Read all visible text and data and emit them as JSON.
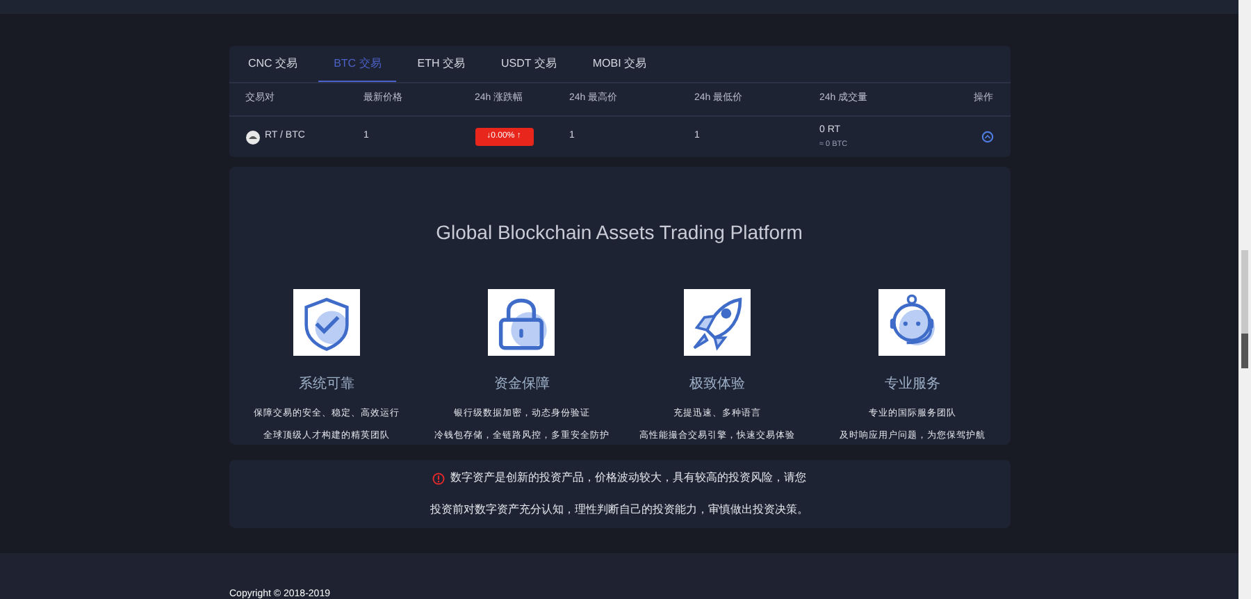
{
  "tabs": [
    {
      "label": "CNC 交易",
      "selected": false
    },
    {
      "label": "BTC 交易",
      "selected": true
    },
    {
      "label": "ETH 交易",
      "selected": false
    },
    {
      "label": "USDT 交易",
      "selected": false
    },
    {
      "label": "MOBI 交易",
      "selected": false
    }
  ],
  "table": {
    "columns": [
      "交易对",
      "最新价格",
      "24h 涨跌幅",
      "24h 最高价",
      "24h 最低价",
      "24h 成交量",
      "操作"
    ],
    "rows": [
      {
        "pair": "RT / BTC",
        "price": "1",
        "change": "↓0.00% ↑",
        "high": "1",
        "low": "1",
        "volume": "0 RT",
        "volume_converted": "≈ 0 BTC"
      }
    ]
  },
  "features": {
    "title": "Global Blockchain Assets Trading Platform",
    "items": [
      {
        "kind": "shield",
        "title": "系统可靠",
        "lines": [
          "保障交易的安全、稳定、高效运行",
          "全球顶级人才构建的精英团队"
        ]
      },
      {
        "kind": "lock",
        "title": "资金保障",
        "lines": [
          "银行级数据加密，动态身份验证",
          "冷钱包存储，全链路风控，多重安全防护"
        ]
      },
      {
        "kind": "rocket",
        "title": "极致体验",
        "lines": [
          "充提迅速、多种语言",
          "高性能撮合交易引擎，快速交易体验"
        ]
      },
      {
        "kind": "support",
        "title": "专业服务",
        "lines": [
          "专业的国际服务团队",
          "及时响应用户问题，为您保驾护航"
        ]
      }
    ]
  },
  "warning": {
    "lines": [
      "数字资产是创新的投资产品，价格波动较大，具有较高的投资风险，请您",
      "投资前对数字资产充分认知，理性判断自己的投资能力，审慎做出投资决策。"
    ]
  },
  "footer": {
    "copyright": "Copyright © 2018-2019"
  }
}
